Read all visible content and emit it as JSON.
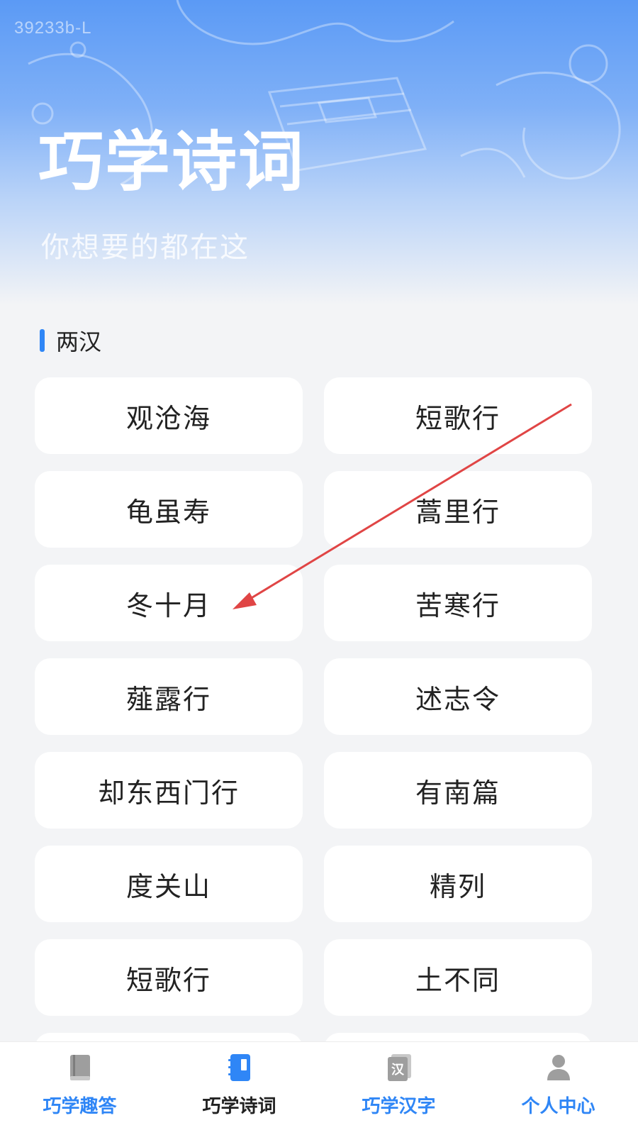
{
  "watermark": "39233b-L",
  "hero": {
    "title": "巧学诗词",
    "subtitle": "你想要的都在这"
  },
  "section": {
    "title": "两汉"
  },
  "poems": [
    {
      "title": "观沧海"
    },
    {
      "title": "短歌行"
    },
    {
      "title": "龟虽寿"
    },
    {
      "title": "蒿里行"
    },
    {
      "title": "冬十月"
    },
    {
      "title": "苦寒行"
    },
    {
      "title": "薤露行"
    },
    {
      "title": "述志令"
    },
    {
      "title": "却东西门行"
    },
    {
      "title": "有南篇"
    },
    {
      "title": "度关山"
    },
    {
      "title": "精列"
    },
    {
      "title": "短歌行"
    },
    {
      "title": "土不同"
    }
  ],
  "tabs": [
    {
      "label": "巧学趣答",
      "icon": "book-icon",
      "active": false
    },
    {
      "label": "巧学诗词",
      "icon": "notebook-icon",
      "active": true
    },
    {
      "label": "巧学汉字",
      "icon": "han-character-icon",
      "icon_text": "汉",
      "active": false
    },
    {
      "label": "个人中心",
      "icon": "user-icon",
      "active": false
    }
  ],
  "colors": {
    "accent": "#2f86f6",
    "arrow": "#e04545",
    "card_bg": "#ffffff",
    "page_bg": "#f3f4f6"
  }
}
